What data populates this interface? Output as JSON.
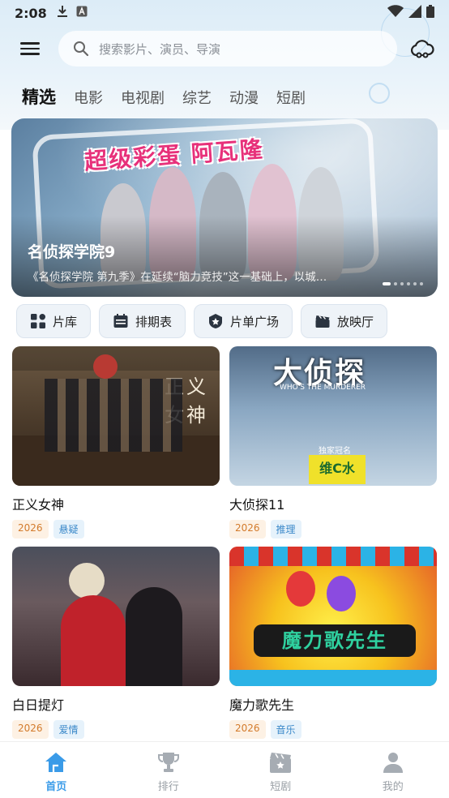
{
  "status_bar": {
    "time": "2:08"
  },
  "search": {
    "placeholder": "搜索影片、演员、导演"
  },
  "tabs": [
    {
      "label": "精选",
      "active": true
    },
    {
      "label": "电影"
    },
    {
      "label": "电视剧"
    },
    {
      "label": "综艺"
    },
    {
      "label": "动漫"
    },
    {
      "label": "短剧"
    }
  ],
  "banner": {
    "headline": "超级彩蛋 阿瓦隆",
    "title": "名侦探学院9",
    "description": "《名侦探学院 第九季》在延续“脑力竞技”这一基础上，以城…",
    "slide_count": 6,
    "active_slide": 1
  },
  "quick_actions": [
    {
      "label": "片库",
      "icon": "grid-icon"
    },
    {
      "label": "排期表",
      "icon": "calendar-icon"
    },
    {
      "label": "片单广场",
      "icon": "badge-star-icon"
    },
    {
      "label": "放映厅",
      "icon": "clapperboard-icon"
    }
  ],
  "cards": [
    {
      "title": "正义女神",
      "year": "2026",
      "genre": "悬疑"
    },
    {
      "title": "大侦探11",
      "year": "2026",
      "genre": "推理"
    },
    {
      "title": "白日提灯",
      "year": "2026",
      "genre": "爱情"
    },
    {
      "title": "魔力歌先生",
      "year": "2026",
      "genre": "音乐"
    }
  ],
  "poster_text": {
    "court_sign": "正义女神",
    "detective_logo": "大侦探",
    "detective_sub": "WHO'S THE MURDERER",
    "sponsor": "独家冠名",
    "sponsor_brand": "维C水",
    "music_logo": "魔力歌先生"
  },
  "bottom_nav": [
    {
      "label": "首页",
      "icon": "home-icon",
      "active": true
    },
    {
      "label": "排行",
      "icon": "trophy-icon"
    },
    {
      "label": "短剧",
      "icon": "short-drama-icon"
    },
    {
      "label": "我的",
      "icon": "profile-icon"
    }
  ],
  "colors": {
    "accent": "#3a9be8",
    "year_tag": "#d37b2c",
    "genre_tag": "#3a88c9"
  }
}
